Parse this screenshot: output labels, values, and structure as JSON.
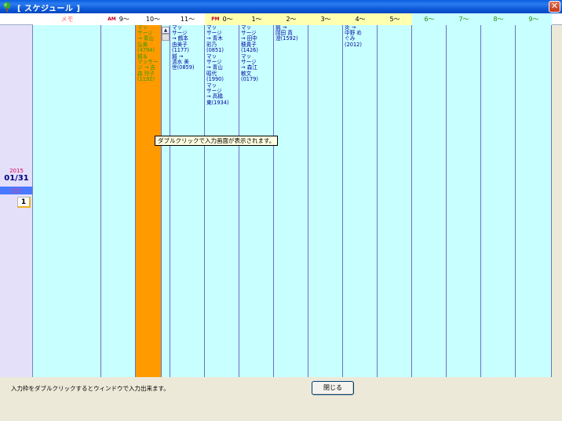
{
  "window": {
    "title": "[ スケジュール ]",
    "close_glyph": "✕",
    "icon": "tree-icon"
  },
  "header": {
    "memo": "メモ",
    "am": "AM",
    "pm": "PM",
    "hours": [
      "9〜",
      "10〜",
      "11〜",
      "0〜",
      "1〜",
      "2〜",
      "3〜",
      "4〜",
      "5〜",
      "6〜",
      "7〜",
      "8〜",
      "9〜"
    ],
    "colors": {
      "memo_bg": "#FFFFFF",
      "memo_fg": "#FF6060",
      "am_bg": "#FFFFFF",
      "noon_bg": "#FFFFB0",
      "pm_bg": "#FFFFB0",
      "evening_bg": "#C8FFFF",
      "evening_fg": "#209000"
    }
  },
  "date_panel": {
    "year": "2015",
    "date": "01/31",
    "weekday": "(土)",
    "count": "1"
  },
  "columns": {
    "col_10": [
      {
        "text": "マッ\nサージ\n→ 青山\n弘美\n(4794)",
        "style": "green"
      },
      {
        "text": "鍼＆\nマッサー\nジ → 吉\n森 玲子\n(1192)",
        "style": "green"
      }
    ],
    "col_11": [
      {
        "text": "マッ\nサージ\n→ 鶴本\n由美子\n(1177)",
        "style": "normal"
      },
      {
        "text": "鍼 →\n清水 美\n世(0859)",
        "style": "normal"
      }
    ],
    "col_0": [
      {
        "text": "マッ\nサージ\n→ 青木\n彩乃\n(0851)",
        "style": "normal"
      },
      {
        "text": "マッ\nサージ\n→ 青山\n昭代\n(1990)",
        "style": "normal"
      },
      {
        "text": "マッ\nサージ\n→ 高橋\n東(1934)",
        "style": "normal"
      }
    ],
    "col_1": [
      {
        "text": "マッ\nサージ\n→ 田中\n穂貴子\n(1426)",
        "style": "normal"
      },
      {
        "text": "マッ\nサージ\n→ 森江\n敏文\n(0179)",
        "style": "normal"
      }
    ],
    "col_2": [
      {
        "text": "鍼 →\n岡田 真\n澄(1592)",
        "style": "normal"
      }
    ],
    "col_4": [
      {
        "text": "灸 →\n中野 め\nぐみ\n(2012)",
        "style": "normal"
      }
    ]
  },
  "tooltip": "ダブルクリックで入力画面が表示されます。",
  "footer": {
    "hint": "入力枠をダブルクリックするとウィンドウで入力出来ます。",
    "close_button": "閉じる"
  },
  "colors": {
    "slot_bg": "#C8FFFF",
    "highlight_slot": "#FF9A00",
    "date_bg": "#E4E0FA"
  }
}
